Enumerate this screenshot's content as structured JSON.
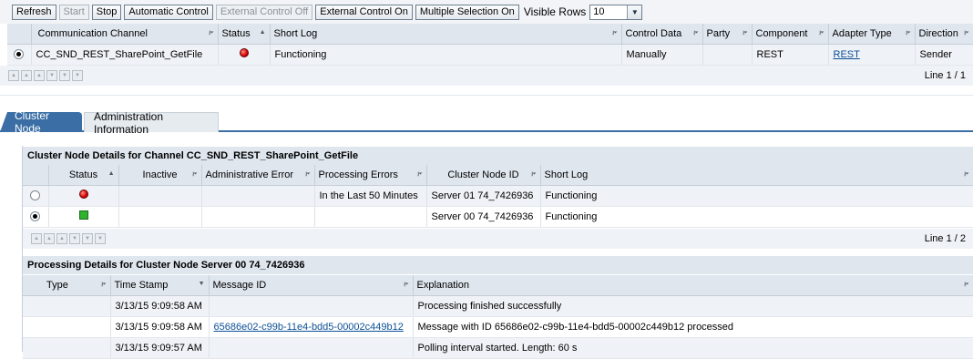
{
  "toolbar": {
    "buttons": [
      {
        "label": "Refresh",
        "enabled": true
      },
      {
        "label": "Start",
        "enabled": false
      },
      {
        "label": "Stop",
        "enabled": true
      },
      {
        "label": "Automatic Control",
        "enabled": true
      },
      {
        "label": "External Control Off",
        "enabled": false
      },
      {
        "label": "External Control On",
        "enabled": true
      },
      {
        "label": "Multiple Selection On",
        "enabled": true
      }
    ],
    "visible_rows_label": "Visible Rows",
    "visible_rows_value": "10"
  },
  "channels_table": {
    "columns": [
      "Communication Channel",
      "Status",
      "Short Log",
      "Control Data",
      "Party",
      "Component",
      "Adapter Type",
      "Direction"
    ],
    "rows": [
      {
        "channel": "CC_SND_REST_SharePoint_GetFile",
        "status": "red",
        "short_log": "Functioning",
        "control_data": "Manually",
        "party": "",
        "component": "REST",
        "adapter_type": "REST",
        "direction": "Sender"
      }
    ],
    "pager_text": "Line 1 / 1"
  },
  "tabs": [
    {
      "label": "Cluster Node",
      "active": true
    },
    {
      "label": "Administration Information",
      "active": false
    }
  ],
  "cluster_details": {
    "title": "Cluster Node Details for Channel CC_SND_REST_SharePoint_GetFile",
    "columns": [
      "Status",
      "Inactive",
      "Administrative Error",
      "Processing Errors",
      "Cluster Node ID",
      "Short Log"
    ],
    "rows": [
      {
        "status": "red",
        "inactive": "",
        "admin_error": "",
        "processing_errors": "In the Last 50 Minutes",
        "node_id": "Server 01 74_7426936",
        "short_log": "Functioning"
      },
      {
        "status": "green",
        "inactive": "",
        "admin_error": "",
        "processing_errors": "",
        "node_id": "Server 00 74_7426936",
        "short_log": "Functioning"
      }
    ],
    "pager_text": "Line 1 / 2"
  },
  "processing_details": {
    "title": "Processing Details for Cluster Node Server 00 74_7426936",
    "columns": [
      "Type",
      "Time Stamp",
      "Message ID",
      "Explanation"
    ],
    "rows": [
      {
        "type": "",
        "timestamp": "3/13/15 9:09:58 AM",
        "message_id": "",
        "explanation": "Processing finished successfully"
      },
      {
        "type": "",
        "timestamp": "3/13/15 9:09:58 AM",
        "message_id": "65686e02-c99b-11e4-bdd5-00002c449b12",
        "explanation": "Message with ID 65686e02-c99b-11e4-bdd5-00002c449b12 processed"
      },
      {
        "type": "",
        "timestamp": "3/13/15 9:09:57 AM",
        "message_id": "",
        "explanation": "Polling interval started. Length: 60 s"
      }
    ]
  },
  "colors": {
    "accent": "#3a6ea5",
    "header_bg": "#dfe6ee",
    "status_red": "#d50000",
    "status_green": "#2fb32f"
  }
}
